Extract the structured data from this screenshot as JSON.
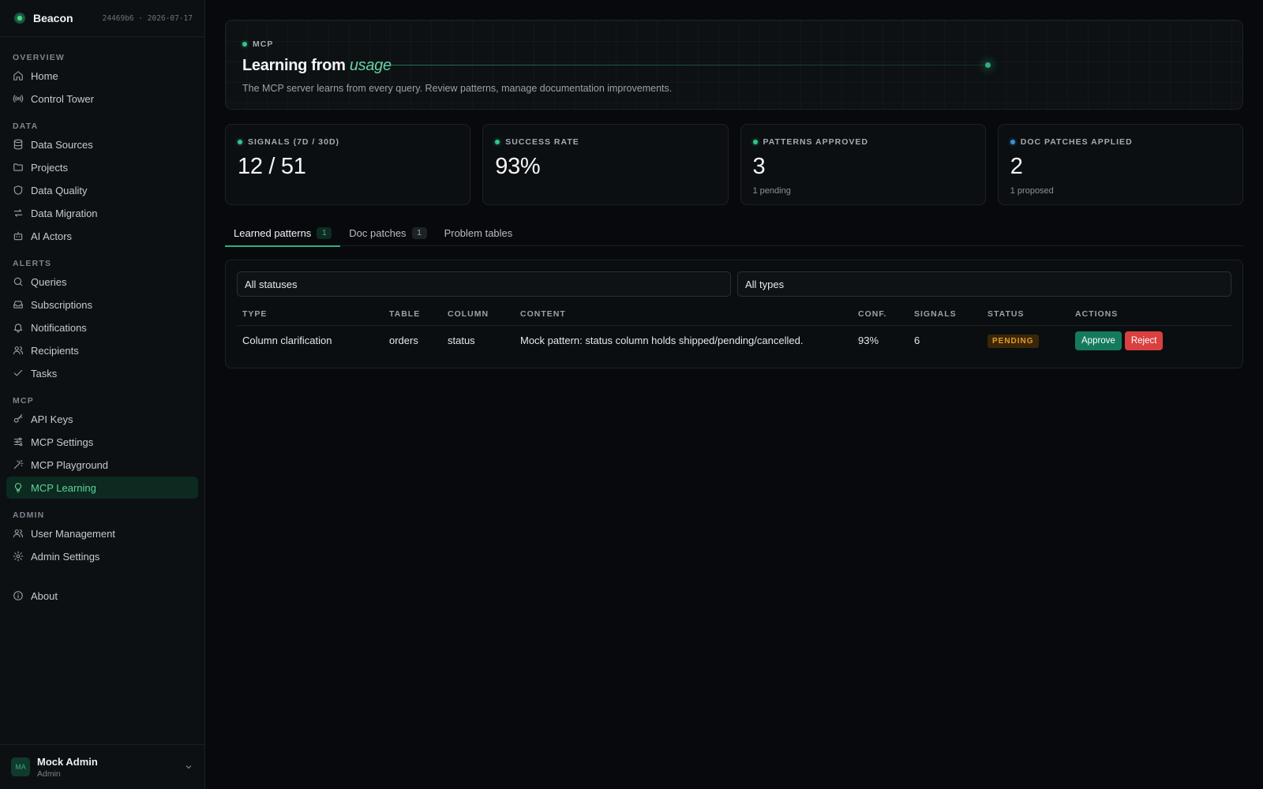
{
  "brand": {
    "name": "Beacon",
    "meta": "24469b6 · 2026-07-17"
  },
  "nav": {
    "sections": [
      {
        "title": "OVERVIEW",
        "items": [
          {
            "label": "Home",
            "icon": "home-icon"
          },
          {
            "label": "Control Tower",
            "icon": "radio-tower-icon"
          }
        ]
      },
      {
        "title": "DATA",
        "items": [
          {
            "label": "Data Sources",
            "icon": "database-icon"
          },
          {
            "label": "Projects",
            "icon": "folder-icon"
          },
          {
            "label": "Data Quality",
            "icon": "shield-icon"
          },
          {
            "label": "Data Migration",
            "icon": "arrows-swap-icon"
          },
          {
            "label": "AI Actors",
            "icon": "bot-icon"
          }
        ]
      },
      {
        "title": "ALERTS",
        "items": [
          {
            "label": "Queries",
            "icon": "search-icon"
          },
          {
            "label": "Subscriptions",
            "icon": "inbox-icon"
          },
          {
            "label": "Notifications",
            "icon": "bell-icon"
          },
          {
            "label": "Recipients",
            "icon": "users-icon"
          },
          {
            "label": "Tasks",
            "icon": "check-icon"
          }
        ]
      },
      {
        "title": "MCP",
        "items": [
          {
            "label": "API Keys",
            "icon": "key-icon"
          },
          {
            "label": "MCP Settings",
            "icon": "sliders-icon"
          },
          {
            "label": "MCP Playground",
            "icon": "wand-icon"
          },
          {
            "label": "MCP Learning",
            "icon": "lightbulb-icon",
            "active": true
          }
        ]
      },
      {
        "title": "ADMIN",
        "items": [
          {
            "label": "User Management",
            "icon": "users-icon"
          },
          {
            "label": "Admin Settings",
            "icon": "gear-icon"
          }
        ]
      }
    ],
    "about": {
      "label": "About",
      "icon": "info-icon"
    }
  },
  "user": {
    "initials": "MA",
    "name": "Mock Admin",
    "role": "Admin"
  },
  "hero": {
    "tag": "MCP",
    "title_main": "Learning from",
    "title_accent": "usage",
    "subtitle": "The MCP server learns from every query. Review patterns, manage documentation improvements."
  },
  "stats": [
    {
      "label": "SIGNALS (7D / 30D)",
      "value": "12 / 51",
      "note": "",
      "dot": "green"
    },
    {
      "label": "SUCCESS RATE",
      "value": "93%",
      "note": "",
      "dot": "green"
    },
    {
      "label": "PATTERNS APPROVED",
      "value": "3",
      "note": "1 pending",
      "dot": "green"
    },
    {
      "label": "DOC PATCHES APPLIED",
      "value": "2",
      "note": "1 proposed",
      "dot": "blue"
    }
  ],
  "tabs": [
    {
      "label": "Learned patterns",
      "badge": "1",
      "active": true
    },
    {
      "label": "Doc patches",
      "badge": "1"
    },
    {
      "label": "Problem tables",
      "badge": ""
    }
  ],
  "filters": {
    "status": "All statuses",
    "type": "All types"
  },
  "table": {
    "headers": [
      "TYPE",
      "TABLE",
      "COLUMN",
      "CONTENT",
      "CONF.",
      "SIGNALS",
      "STATUS",
      "ACTIONS"
    ],
    "rows": [
      {
        "type": "Column clarification",
        "table": "orders",
        "column": "status",
        "content": "Mock pattern: status column holds shipped/pending/cancelled.",
        "conf": "93%",
        "signals": "6",
        "status": "PENDING",
        "approve_label": "Approve",
        "reject_label": "Reject"
      }
    ]
  }
}
